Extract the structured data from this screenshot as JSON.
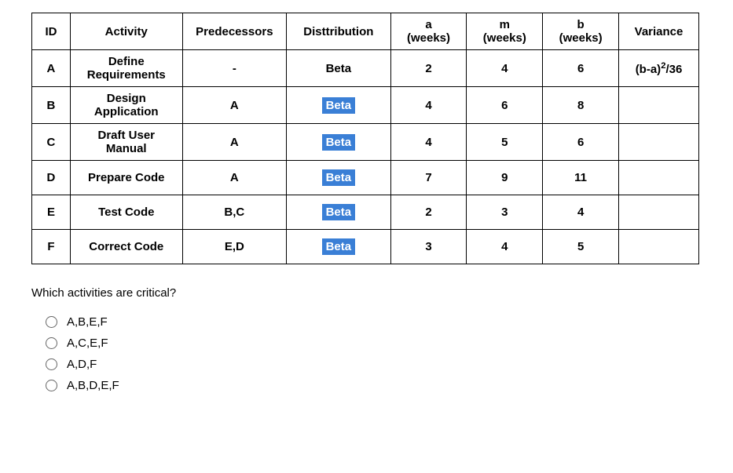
{
  "table": {
    "headers": [
      "ID",
      "Activity",
      "Predecessors",
      "Disttribution",
      "a\n(weeks)",
      "m\n(weeks)",
      "b\n(weeks)",
      "Variance"
    ],
    "header_line1": [
      "ID",
      "Activity",
      "Predecessors",
      "Disttribution",
      "a",
      "m",
      "b",
      "Variance"
    ],
    "header_line2": [
      "",
      "",
      "",
      "",
      "(weeks)",
      "(weeks)",
      "(weeks)",
      ""
    ],
    "rows": [
      {
        "id": "A",
        "activity": "Define Requirements",
        "pred": "-",
        "dist": "Beta",
        "hl": false,
        "a": "2",
        "m": "4",
        "b": "6",
        "var": "(b-a)2/36"
      },
      {
        "id": "B",
        "activity": "Design Application",
        "pred": "A",
        "dist": "Beta",
        "hl": true,
        "a": "4",
        "m": "6",
        "b": "8",
        "var": ""
      },
      {
        "id": "C",
        "activity": "Draft User Manual",
        "pred": "A",
        "dist": "Beta",
        "hl": true,
        "a": "4",
        "m": "5",
        "b": "6",
        "var": ""
      },
      {
        "id": "D",
        "activity": "Prepare Code",
        "pred": "A",
        "dist": "Beta",
        "hl": true,
        "a": "7",
        "m": "9",
        "b": "11",
        "var": ""
      },
      {
        "id": "E",
        "activity": "Test Code",
        "pred": "B,C",
        "dist": "Beta",
        "hl": true,
        "a": "2",
        "m": "3",
        "b": "4",
        "var": ""
      },
      {
        "id": "F",
        "activity": "Correct Code",
        "pred": "E,D",
        "dist": "Beta",
        "hl": true,
        "a": "3",
        "m": "4",
        "b": "5",
        "var": ""
      }
    ]
  },
  "question": "Which activities are critical?",
  "options": [
    "A,B,E,F",
    "A,C,E,F",
    "A,D,F",
    "A,B,D,E,F"
  ]
}
